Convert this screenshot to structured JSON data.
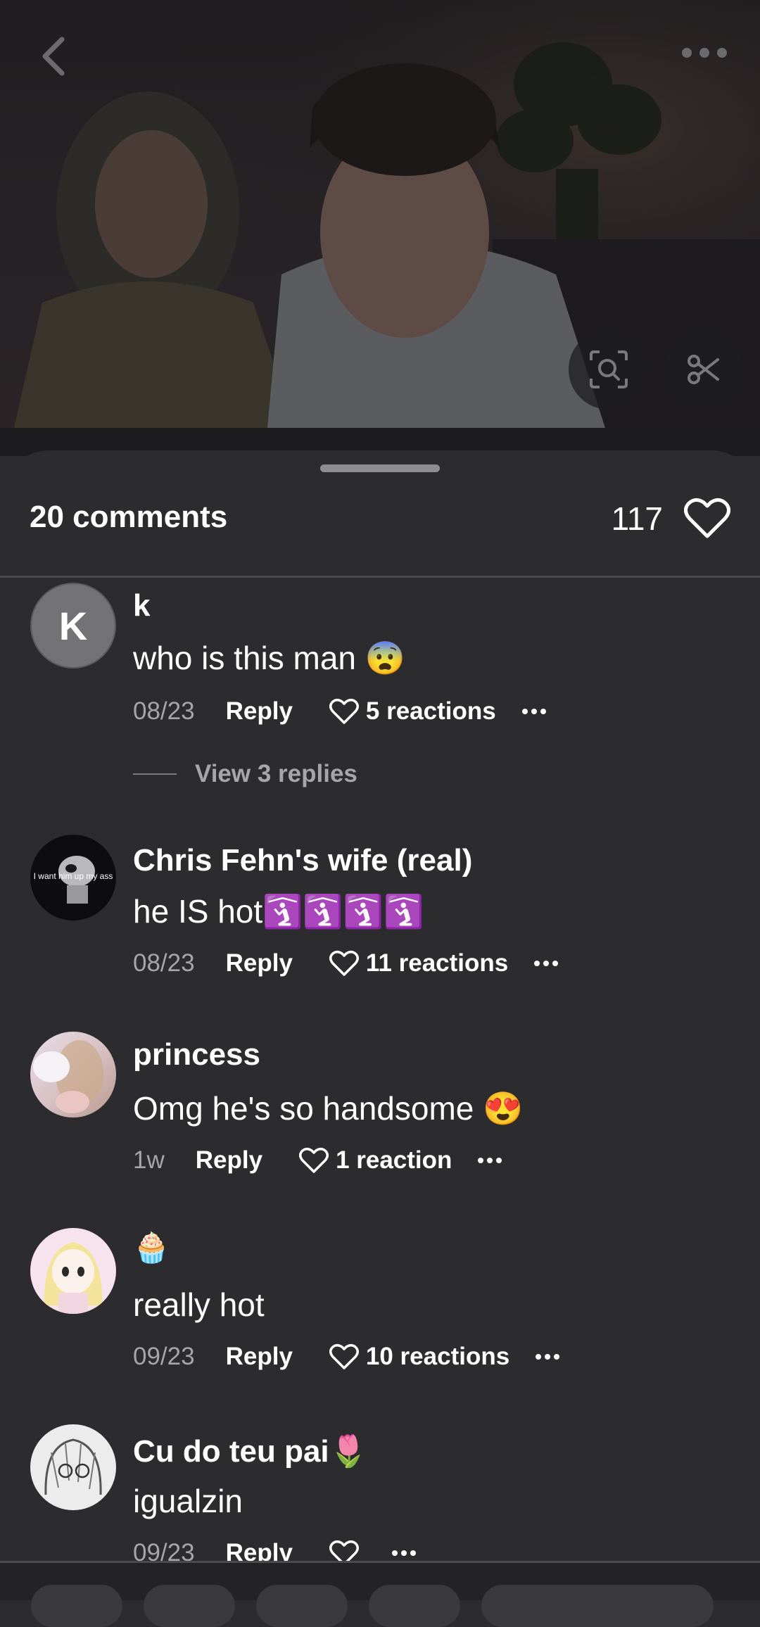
{
  "header": {
    "comment_count_label": "20 comments",
    "likes_total": "117"
  },
  "comments": [
    {
      "avatar_letter": "K",
      "username": "k",
      "text": "who is this man 😨",
      "date": "08/23",
      "reply_label": "Reply",
      "reactions": "5 reactions",
      "view_replies": "View 3 replies"
    },
    {
      "avatar_caption": "I want him up my ass",
      "username": "Chris Fehn's wife (real)",
      "text": "he IS hot🛐🛐🛐🛐",
      "date": "08/23",
      "reply_label": "Reply",
      "reactions": "11 reactions"
    },
    {
      "username": "princess",
      "text": "Omg he's so handsome 😍",
      "date": "1w",
      "reply_label": "Reply",
      "reactions": "1 reaction"
    },
    {
      "username": "🧁",
      "text": "really hot",
      "date": "09/23",
      "reply_label": "Reply",
      "reactions": "10 reactions"
    },
    {
      "username": "Cu do teu pai🌷",
      "text": "igualzin",
      "date": "09/23",
      "reply_label": "Reply",
      "reactions": ""
    }
  ],
  "colors": {
    "background": "#2c2c2e",
    "muted_text": "#a5a5aa",
    "divider": "#4a4a4e"
  }
}
